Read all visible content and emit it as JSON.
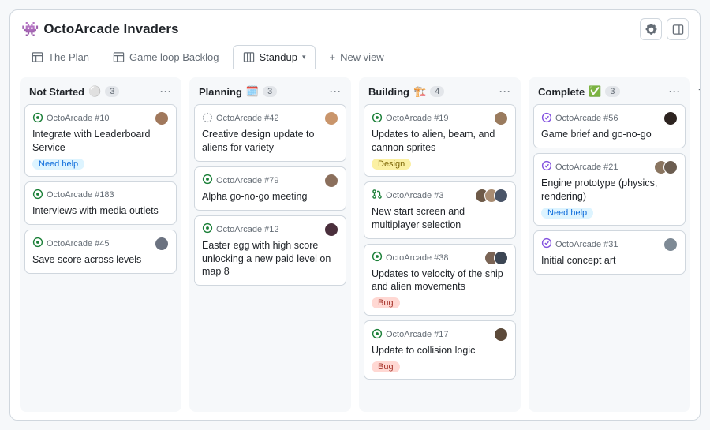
{
  "project": {
    "emoji": "👾",
    "title": "OctoArcade Invaders"
  },
  "tabs": [
    {
      "label": "The Plan"
    },
    {
      "label": "Game loop Backlog"
    },
    {
      "label": "Standup"
    },
    {
      "label": "New view"
    }
  ],
  "columns": [
    {
      "title": "Not Started",
      "emoji": "⚪",
      "count": "3",
      "cards": [
        {
          "repo": "OctoArcade #10",
          "title": "Integrate with Leaderboard Service",
          "status": "open",
          "labels": [
            {
              "text": "Need help",
              "bg": "#ddf4ff",
              "fg": "#0969da"
            }
          ],
          "avatars": [
            "#a0785c"
          ]
        },
        {
          "repo": "OctoArcade #183",
          "title": "Interviews with media outlets",
          "status": "open",
          "labels": [],
          "avatars": []
        },
        {
          "repo": "OctoArcade #45",
          "title": "Save score across levels",
          "status": "open",
          "labels": [],
          "avatars": [
            "#6b7280"
          ]
        }
      ]
    },
    {
      "title": "Planning",
      "emoji": "🗓️",
      "count": "3",
      "cards": [
        {
          "repo": "OctoArcade #42",
          "title": "Creative design update to aliens for variety",
          "status": "draft",
          "labels": [],
          "avatars": [
            "#c9956b"
          ]
        },
        {
          "repo": "OctoArcade #79",
          "title": "Alpha go-no-go meeting",
          "status": "open",
          "labels": [],
          "avatars": [
            "#8b6f5c"
          ]
        },
        {
          "repo": "OctoArcade #12",
          "title": "Easter egg with high score unlocking a new paid level on map 8",
          "status": "open",
          "labels": [],
          "avatars": [
            "#4a2f3c"
          ]
        }
      ]
    },
    {
      "title": "Building",
      "emoji": "🏗️",
      "count": "4",
      "cards": [
        {
          "repo": "OctoArcade #19",
          "title": "Updates to alien, beam, and cannon sprites",
          "status": "open",
          "labels": [
            {
              "text": "Design",
              "bg": "#fbf0a3",
              "fg": "#7d6606"
            }
          ],
          "avatars": [
            "#9a7b5e"
          ]
        },
        {
          "repo": "OctoArcade #3",
          "title": "New start screen and multiplayer selection",
          "status": "pr",
          "labels": [],
          "avatars": [
            "#6e5a48",
            "#a88c72",
            "#4a5568"
          ]
        },
        {
          "repo": "OctoArcade #38",
          "title": "Updates to velocity of the ship and alien movements",
          "status": "open",
          "labels": [
            {
              "text": "Bug",
              "bg": "#ffd8d3",
              "fg": "#a6332a"
            }
          ],
          "avatars": [
            "#7a6455",
            "#3c4654"
          ]
        },
        {
          "repo": "OctoArcade #17",
          "title": "Update to collision logic",
          "status": "open",
          "labels": [
            {
              "text": "Bug",
              "bg": "#ffd8d3",
              "fg": "#a6332a"
            }
          ],
          "avatars": [
            "#5c4a3a"
          ]
        }
      ]
    },
    {
      "title": "Complete",
      "emoji": "✅",
      "count": "3",
      "cards": [
        {
          "repo": "OctoArcade #56",
          "title": "Game brief and go-no-go",
          "status": "done",
          "labels": [],
          "avatars": [
            "#2d2420"
          ]
        },
        {
          "repo": "OctoArcade #21",
          "title": "Engine prototype (physics, rendering)",
          "status": "done",
          "labels": [
            {
              "text": "Need help",
              "bg": "#ddf4ff",
              "fg": "#0969da"
            }
          ],
          "avatars": [
            "#8a7560",
            "#6b5d50"
          ]
        },
        {
          "repo": "OctoArcade #31",
          "title": "Initial concept art",
          "status": "done",
          "labels": [],
          "avatars": [
            "#7e8a95"
          ]
        }
      ]
    }
  ]
}
